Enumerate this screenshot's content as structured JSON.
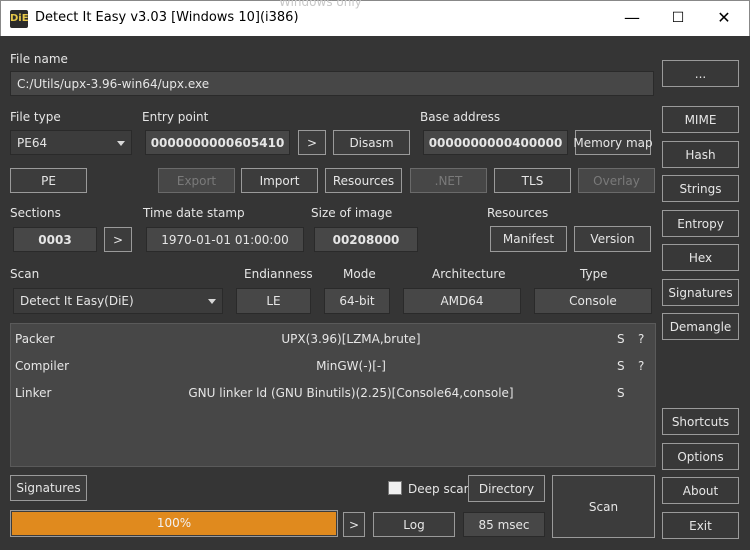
{
  "window": {
    "title": "Detect It Easy v3.03 [Windows 10](i386)",
    "ghost_text": "Windows only",
    "icon_text": "DiE",
    "minimize": "—",
    "maximize": "☐",
    "close": "✕"
  },
  "file": {
    "label": "File name",
    "path": "C:/Utils/upx-3.96-win64/upx.exe",
    "browse_button": "..."
  },
  "filetype": {
    "label": "File type",
    "value": "PE64"
  },
  "entry": {
    "label": "Entry point",
    "value": "0000000000605410",
    "go_button": ">",
    "disasm_button": "Disasm"
  },
  "base": {
    "label": "Base address",
    "value": "0000000000400000",
    "memory_map_button": "Memory map"
  },
  "pe_buttons": {
    "pe": "PE",
    "export": "Export",
    "import": "Import",
    "resources": "Resources",
    "net": ".NET",
    "tls": "TLS",
    "overlay": "Overlay"
  },
  "sections": {
    "label": "Sections",
    "value": "0003",
    "go_button": ">"
  },
  "timedate": {
    "label": "Time date stamp",
    "value": "1970-01-01 01:00:00"
  },
  "sizeimage": {
    "label": "Size of image",
    "value": "00208000"
  },
  "resources": {
    "label": "Resources",
    "manifest_button": "Manifest",
    "version_button": "Version"
  },
  "scan": {
    "label": "Scan",
    "value": "Detect It Easy(DiE)"
  },
  "endianness": {
    "label": "Endianness",
    "value": "LE"
  },
  "mode": {
    "label": "Mode",
    "value": "64-bit"
  },
  "architecture": {
    "label": "Architecture",
    "value": "AMD64"
  },
  "type": {
    "label": "Type",
    "value": "Console"
  },
  "results": [
    {
      "type": "Packer",
      "value": "UPX(3.96)[LZMA,brute]",
      "s": "S",
      "q": "?"
    },
    {
      "type": "Compiler",
      "value": "MinGW(-)[-]",
      "s": "S",
      "q": "?"
    },
    {
      "type": "Linker",
      "value": "GNU linker ld (GNU Binutils)(2.25)[Console64,console]",
      "s": "S",
      "q": ""
    }
  ],
  "sidebar": {
    "mime": "MIME",
    "hash": "Hash",
    "strings": "Strings",
    "entropy": "Entropy",
    "hex": "Hex",
    "signatures": "Signatures",
    "demangle": "Demangle",
    "shortcuts": "Shortcuts",
    "options": "Options",
    "about": "About",
    "exit": "Exit"
  },
  "bottom": {
    "signatures_button": "Signatures",
    "deep_scan_label": "Deep scan",
    "deep_scan_checked": false,
    "directory_button": "Directory",
    "scan_button": "Scan",
    "progress_text": "100%",
    "progress_fraction": 1.0,
    "progress_go": ">",
    "log_button": "Log",
    "time_text": "85 msec"
  },
  "colors": {
    "progress": "#e08a1e",
    "background": "#353535"
  }
}
